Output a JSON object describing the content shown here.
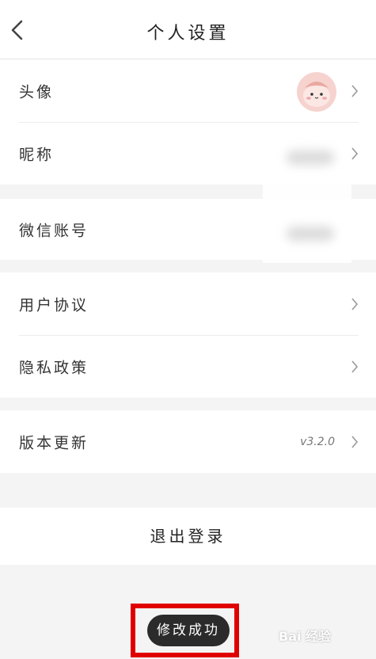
{
  "header": {
    "title": "个人设置"
  },
  "profile": {
    "avatar_label": "头像",
    "nickname_label": "昵称"
  },
  "account": {
    "wechat_label": "微信账号"
  },
  "legal": {
    "agreement_label": "用户协议",
    "privacy_label": "隐私政策"
  },
  "version": {
    "label": "版本更新",
    "value": "v3.2.0"
  },
  "logout_label": "退出登录",
  "toast": {
    "message": "修改成功"
  },
  "watermark": "Bai 经验",
  "colors": {
    "highlight_border": "#e00000",
    "toast_bg": "#2b2b2b",
    "page_bg": "#f4f4f4"
  },
  "icons": [
    "back-icon",
    "chevron-right-icon",
    "avatar"
  ]
}
